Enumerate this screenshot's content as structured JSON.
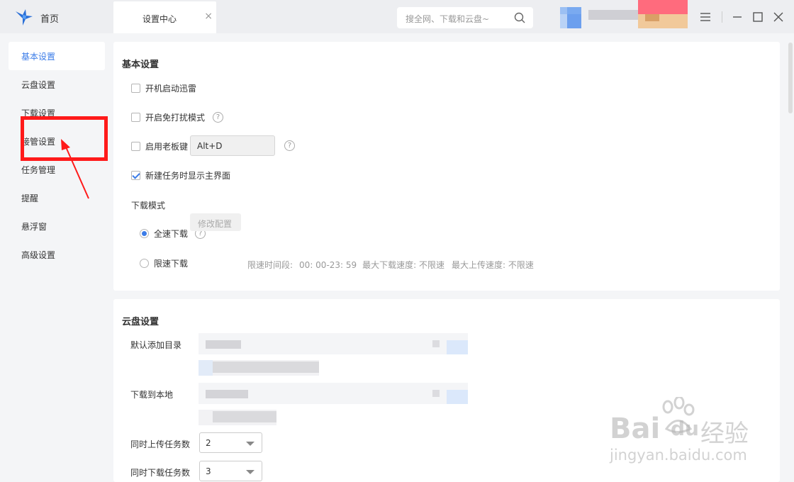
{
  "topbar": {
    "home_label": "首页",
    "tab_label": "设置中心",
    "tab_close": "×",
    "search_placeholder": "搜全网、下载和云盘~"
  },
  "sidebar": {
    "items": [
      {
        "label": "基本设置",
        "active": true
      },
      {
        "label": "云盘设置"
      },
      {
        "label": "下载设置"
      },
      {
        "label": "接管设置"
      },
      {
        "label": "任务管理"
      },
      {
        "label": "提醒"
      },
      {
        "label": "悬浮窗"
      },
      {
        "label": "高级设置"
      }
    ]
  },
  "basic": {
    "title": "基本设置",
    "autostart": "开机启动迅雷",
    "nodisturb": "开启免打扰模式",
    "bosskey": "启用老板键",
    "bosskey_value": "Alt+D",
    "showmain": "新建任务时显示主界面",
    "mode_title": "下载模式",
    "fullspeed": "全速下载",
    "limitspeed": "限速下载",
    "modify_btn": "修改配置",
    "limit_time_label": "限速时间段:",
    "limit_time_value": "00: 00-23: 59",
    "max_down": "最大下载速度: 不限速",
    "max_up": "最大上传速度: 不限速",
    "help": "?"
  },
  "cloud": {
    "title": "云盘设置",
    "default_dir": "默认添加目录",
    "download_local": "下载到本地",
    "upload_tasks_label": "同时上传任务数",
    "upload_tasks_value": "2",
    "download_tasks_label": "同时下载任务数",
    "download_tasks_value": "3"
  },
  "watermark": {
    "brand": "Bai",
    "brand2": "du",
    "cn": "经验",
    "url": "jingyan.baidu.com"
  },
  "colors": {
    "accent": "#3b7ce8",
    "annotation": "#ff1a1a"
  }
}
